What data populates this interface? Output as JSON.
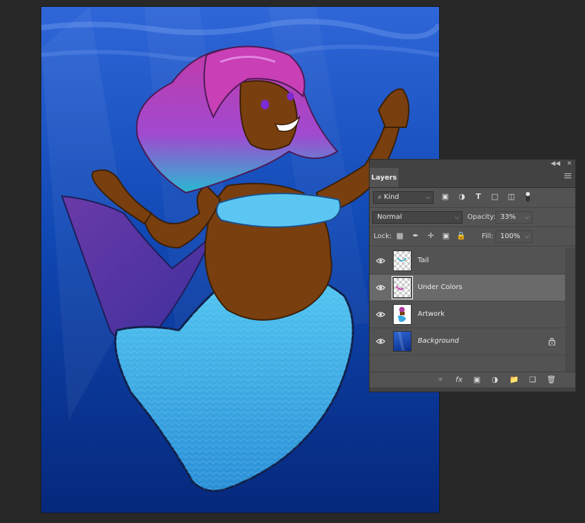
{
  "canvas": {
    "description_icon": "mermaid-artwork"
  },
  "panel": {
    "collapse_icon": "double-chevron-icon",
    "close_icon": "close-icon",
    "tab_label": "Layers",
    "filter_kind_label": "Kind",
    "blend_mode": "Normal",
    "opacity_label": "Opacity:",
    "opacity_value": "33%",
    "lock_label": "Lock:",
    "fill_label": "Fill:",
    "fill_value": "100%",
    "layers": [
      {
        "name": "Tail",
        "visible": true,
        "selected": false
      },
      {
        "name": "Under Colors",
        "visible": true,
        "selected": true
      },
      {
        "name": "Artwork",
        "visible": true,
        "selected": false
      },
      {
        "name": "Background",
        "visible": true,
        "selected": false,
        "locked": true
      }
    ]
  },
  "colors": {
    "app_background": "#282828",
    "panel_background": "#535353",
    "selected_layer": "#6a6a6a",
    "ocean_blue": "#0b3a9a"
  }
}
